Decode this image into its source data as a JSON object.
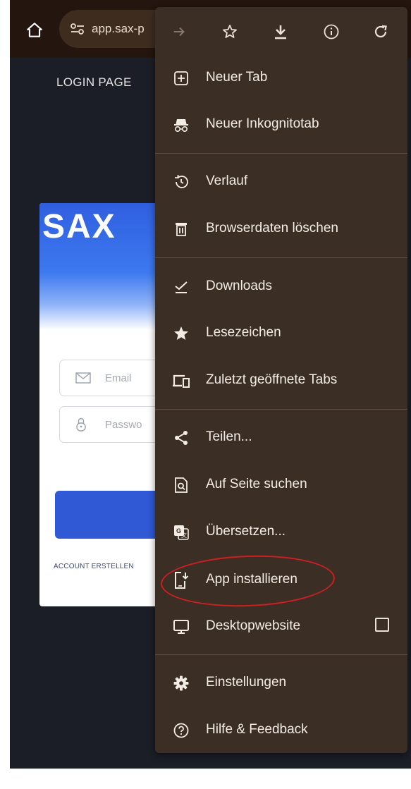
{
  "browser": {
    "url": "app.sax-p",
    "home_icon": "home-icon",
    "site_info_icon": "tune-icon"
  },
  "page": {
    "login_title": "LOGIN PAGE",
    "logo_text": "SAX",
    "email_placeholder": "Email",
    "password_placeholder": "Passwo",
    "account_link": "ACCOUNT ERSTELLEN"
  },
  "menu": {
    "toolbar_icons": [
      "forward-arrow-icon",
      "star-icon",
      "download-icon",
      "info-icon",
      "reload-icon"
    ],
    "items": [
      {
        "label": "Neuer Tab",
        "icon": "new-tab-icon"
      },
      {
        "label": "Neuer Inkognitotab",
        "icon": "incognito-icon"
      },
      {
        "label": "Verlauf",
        "icon": "history-icon"
      },
      {
        "label": "Browserdaten löschen",
        "icon": "trash-icon"
      },
      {
        "label": "Downloads",
        "icon": "downloads-icon"
      },
      {
        "label": "Lesezeichen",
        "icon": "bookmark-star-icon"
      },
      {
        "label": "Zuletzt geöffnete Tabs",
        "icon": "devices-icon"
      },
      {
        "label": "Teilen...",
        "icon": "share-icon"
      },
      {
        "label": "Auf Seite suchen",
        "icon": "find-in-page-icon"
      },
      {
        "label": "Übersetzen...",
        "icon": "translate-icon"
      },
      {
        "label": "App installieren",
        "icon": "install-app-icon"
      },
      {
        "label": "Desktopwebsite",
        "icon": "desktop-icon",
        "checked": false
      },
      {
        "label": "Einstellungen",
        "icon": "settings-gear-icon"
      },
      {
        "label": "Hilfe & Feedback",
        "icon": "help-icon"
      }
    ]
  },
  "colors": {
    "toolbar_bg": "#24150e",
    "menu_bg": "#3b2e25",
    "page_bg": "#1c1e27",
    "highlight": "#d01f22",
    "button_blue": "#3059d6"
  }
}
